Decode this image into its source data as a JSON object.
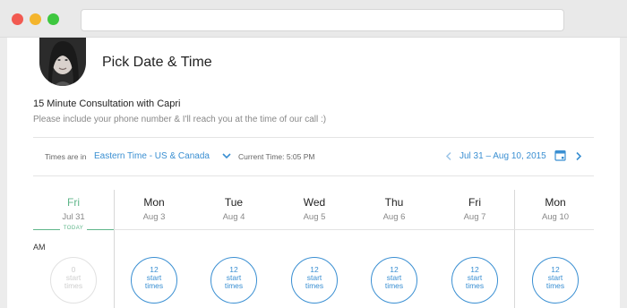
{
  "header": {
    "title": "Pick Date & Time",
    "event_name": "15 Minute Consultation with Capri",
    "event_description": "Please include your phone number & I'll reach you at the time of our call :)"
  },
  "toolbar": {
    "timezone_label": "Times are in",
    "timezone_value": "Eastern Time - US & Canada",
    "current_time": "Current Time: 5:05 PM",
    "date_range": "Jul 31 – Aug 10, 2015"
  },
  "today_label": "TODAY",
  "am_label": "AM",
  "days": [
    {
      "dow": "Fri",
      "date": "Jul 31",
      "count": "0",
      "line1": "start",
      "line2": "times"
    },
    {
      "dow": "Mon",
      "date": "Aug 3",
      "count": "12",
      "line1": "start",
      "line2": "times"
    },
    {
      "dow": "Tue",
      "date": "Aug 4",
      "count": "12",
      "line1": "start",
      "line2": "times"
    },
    {
      "dow": "Wed",
      "date": "Aug 5",
      "count": "12",
      "line1": "start",
      "line2": "times"
    },
    {
      "dow": "Thu",
      "date": "Aug 6",
      "count": "12",
      "line1": "start",
      "line2": "times"
    },
    {
      "dow": "Fri",
      "date": "Aug 7",
      "count": "12",
      "line1": "start",
      "line2": "times"
    },
    {
      "dow": "Mon",
      "date": "Aug 10",
      "count": "12",
      "line1": "start",
      "line2": "times"
    }
  ],
  "colors": {
    "accent": "#3a8fd2",
    "today": "#5fb68a"
  },
  "icons": {
    "timezone_caret": "chevron-down-icon",
    "prev": "chevron-left-icon",
    "calendar": "calendar-icon",
    "next": "chevron-right-icon"
  }
}
